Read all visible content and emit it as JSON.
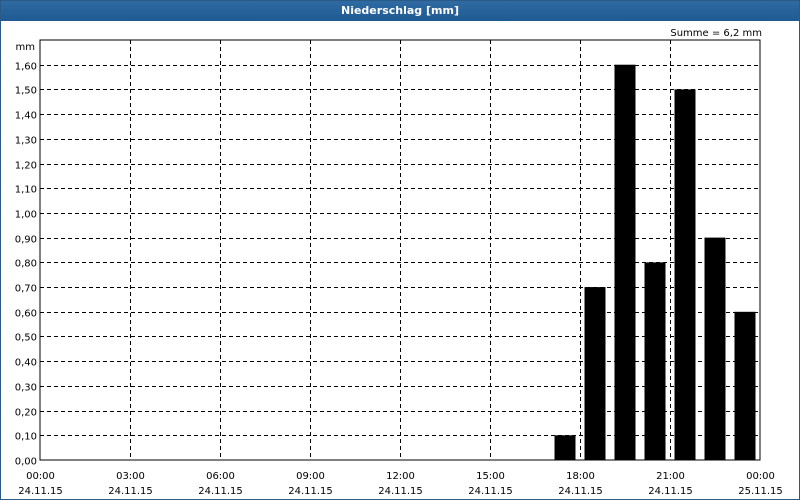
{
  "window": {
    "title": "Niederschlag [mm]"
  },
  "summary": "Summe = 6,2 mm",
  "chart_data": {
    "type": "bar",
    "title": "Niederschlag [mm]",
    "ylabel": "mm",
    "xlabel": "",
    "ylim": [
      0,
      1.7
    ],
    "grid": true,
    "x_range_hours": [
      0,
      24
    ],
    "y_ticks": [
      "0,00",
      "0,10",
      "0,20",
      "0,30",
      "0,40",
      "0,50",
      "0,60",
      "0,70",
      "0,80",
      "0,90",
      "1,00",
      "1,10",
      "1,20",
      "1,30",
      "1,40",
      "1,50",
      "1,60"
    ],
    "x_ticks": [
      {
        "time": "00:00",
        "date": "24.11.15"
      },
      {
        "time": "03:00",
        "date": "24.11.15"
      },
      {
        "time": "06:00",
        "date": "24.11.15"
      },
      {
        "time": "09:00",
        "date": "24.11.15"
      },
      {
        "time": "12:00",
        "date": "24.11.15"
      },
      {
        "time": "15:00",
        "date": "24.11.15"
      },
      {
        "time": "18:00",
        "date": "24.11.15"
      },
      {
        "time": "21:00",
        "date": "24.11.15"
      },
      {
        "time": "00:00",
        "date": "25.11.15"
      }
    ],
    "bars": [
      {
        "hour": 17,
        "value": 0.1
      },
      {
        "hour": 18,
        "value": 0.7
      },
      {
        "hour": 19,
        "value": 1.6
      },
      {
        "hour": 20,
        "value": 0.8
      },
      {
        "hour": 21,
        "value": 1.5
      },
      {
        "hour": 22,
        "value": 0.9
      },
      {
        "hour": 23,
        "value": 0.6
      }
    ],
    "bar_color": "#000000"
  }
}
